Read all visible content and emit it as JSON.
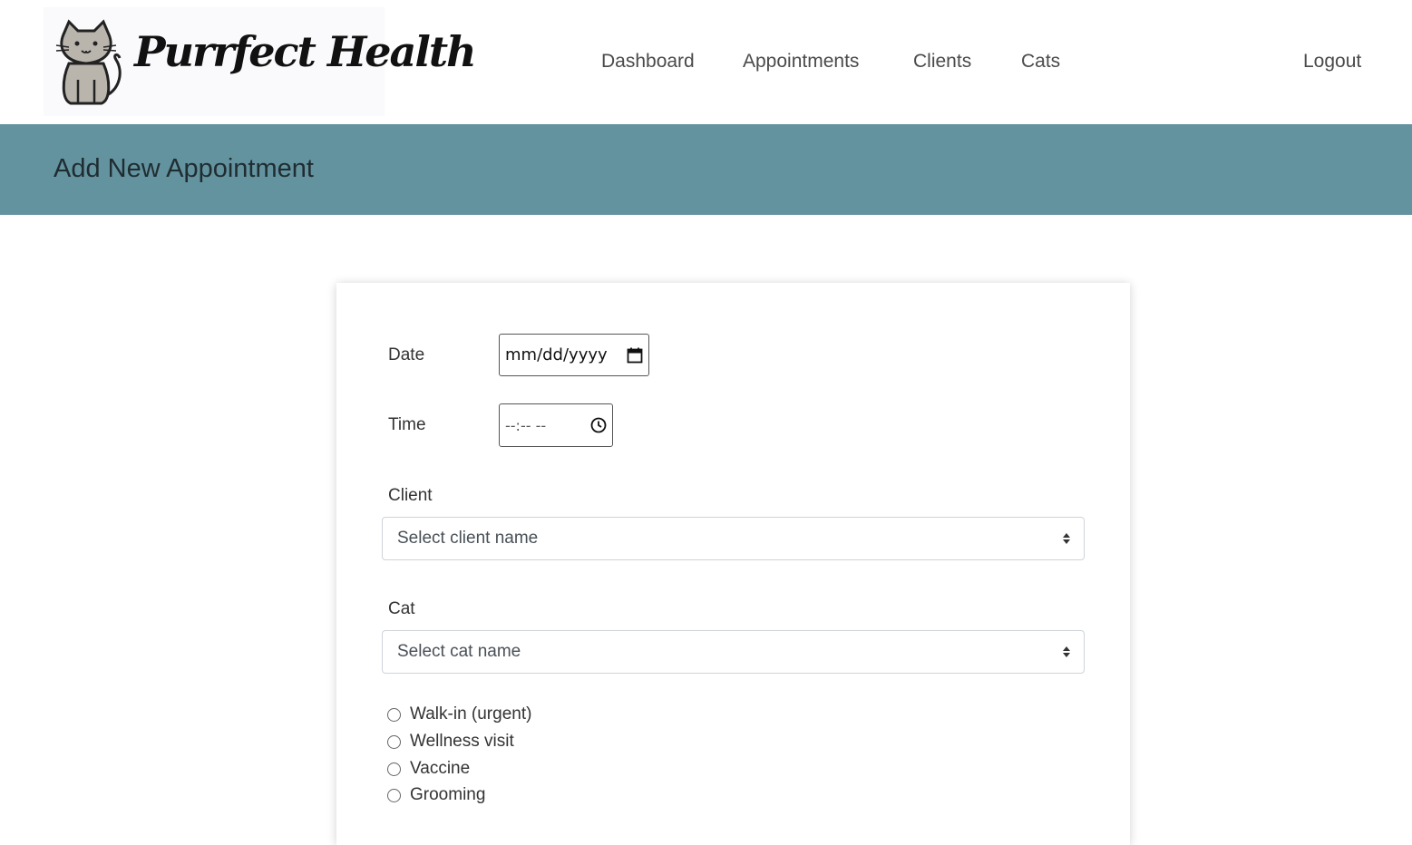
{
  "header": {
    "brand": "Purrfect Health",
    "nav": [
      {
        "label": "Dashboard"
      },
      {
        "label": "Appointments"
      },
      {
        "label": "Clients"
      },
      {
        "label": "Cats"
      }
    ],
    "logout_label": "Logout"
  },
  "banner": {
    "title": "Add New Appointment",
    "color": "#6493a0"
  },
  "form": {
    "date_label": "Date",
    "date_placeholder": "mm/dd/yyyy",
    "time_label": "Time",
    "time_placeholder": "--:-- --",
    "client_label": "Client",
    "client_placeholder": "Select client name",
    "cat_label": "Cat",
    "cat_placeholder": "Select cat name",
    "appointment_types": [
      {
        "label": "Walk-in (urgent)"
      },
      {
        "label": "Wellness visit"
      },
      {
        "label": "Vaccine"
      },
      {
        "label": "Grooming"
      }
    ]
  },
  "icons": {
    "calendar": "calendar-icon",
    "clock": "clock-icon",
    "select_arrows": "sort-arrows-icon"
  }
}
